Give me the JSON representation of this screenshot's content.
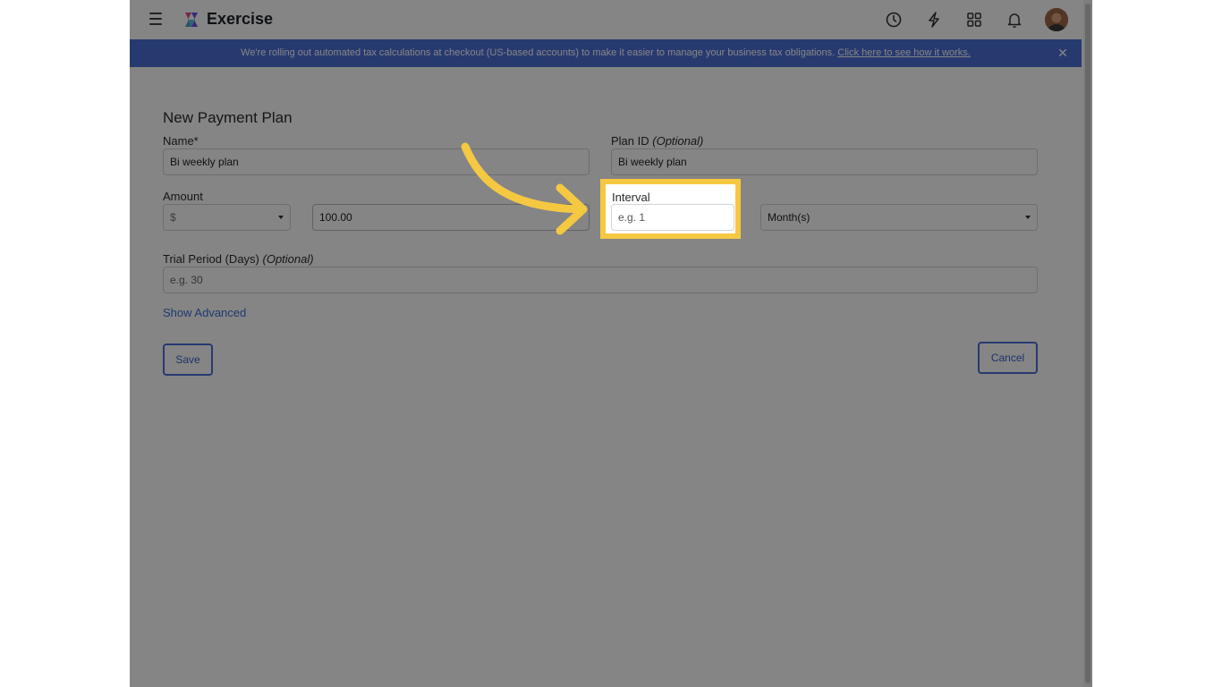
{
  "header": {
    "app_title": "Exercise",
    "icons": [
      "menu-icon",
      "app-logo-icon",
      "history-clock-icon",
      "lightning-icon",
      "apps-grid-icon",
      "notification-bell-icon"
    ]
  },
  "banner": {
    "text": "We're rolling out automated tax calculations at checkout (US-based accounts) to make it easier to manage your business tax obligations.",
    "link_text": "Click here to see how it works.",
    "bg_color": "#4c6fd6"
  },
  "form": {
    "title": "New Payment Plan",
    "name_label": "Name*",
    "name_value": "Bi weekly plan",
    "plan_id_label": "Plan ID",
    "plan_id_optional": "(Optional)",
    "plan_id_value": "Bi weekly plan",
    "amount_label": "Amount",
    "currency_value": "$",
    "amount_value": "100.00",
    "interval_label": "Interval",
    "interval_placeholder": "e.g. 1",
    "interval_unit_value": "Month(s)",
    "trial_label": "Trial Period (Days)",
    "trial_optional": "(Optional)",
    "trial_placeholder": "e.g. 30",
    "show_advanced": "Show Advanced",
    "save_label": "Save",
    "cancel_label": "Cancel"
  },
  "highlight": {
    "color": "#f5c842",
    "target": "Interval"
  }
}
